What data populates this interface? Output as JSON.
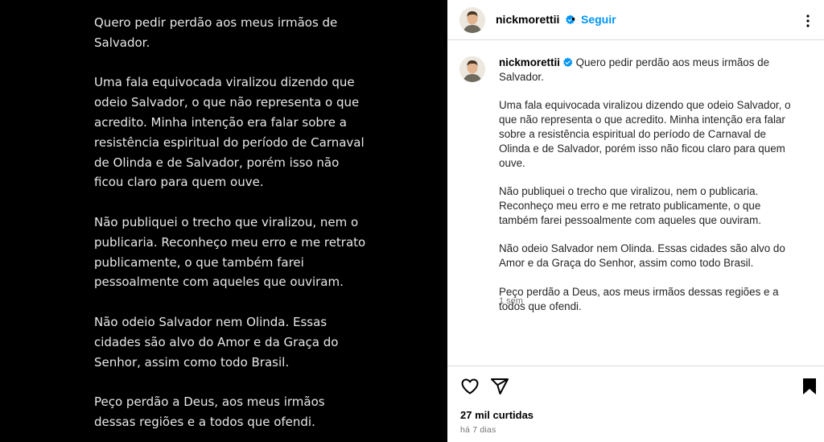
{
  "media": {
    "paragraphs": [
      "Quero pedir perdão aos meus irmãos de Salvador.",
      "Uma fala equivocada viralizou dizendo que odeio Salvador, o que não representa o que acredito. Minha intenção era falar sobre a resistência espiritual do período de Carnaval de Olinda e de Salvador, porém isso não ficou claro para quem ouve.",
      "Não publiquei o trecho que viralizou, nem o publicaria. Reconheço meu erro e me retrato publicamente, o que também farei pessoalmente com aqueles que ouviram.",
      "Não odeio Salvador nem Olinda. Essas cidades são alvo do Amor e da Graça do Senhor, assim como todo Brasil.",
      "Peço perdão a Deus, aos meus irmãos dessas regiões e a todos que ofendi."
    ]
  },
  "header": {
    "username": "nickmorettii",
    "separator": "•",
    "follow_label": "Seguir"
  },
  "caption": {
    "username": "nickmorettii",
    "first": "Quero pedir perdão aos meus irmãos de Salvador.",
    "p2": "Uma fala equivocada viralizou dizendo que odeio Salvador, o que não representa o que acredito. Minha intenção era falar sobre a resistência espiritual do período de Carnaval de Olinda e de Salvador, porém isso não ficou claro para quem ouve.",
    "p3": "Não publiquei o trecho que viralizou, nem o publicaria. Reconheço meu erro e me retrato publicamente, o que também farei pessoalmente com aqueles que ouviram.",
    "p4": "Não odeio Salvador nem Olinda. Essas cidades são alvo do Amor e da Graça do Senhor, assim como todo Brasil.",
    "p5": "Peço perdão a Deus, aos meus irmãos dessas regiões e a todos que ofendi.",
    "time": "1 sem"
  },
  "actions": {
    "likes": "27 mil curtidas",
    "posted": "há 7 dias",
    "icons": [
      "heart-icon",
      "share-icon",
      "bookmark-icon",
      "more-icon",
      "verified-badge-icon"
    ]
  },
  "colors": {
    "accent": "#0095f6",
    "verified": "#0095f6",
    "media_bg": "#000000",
    "border": "#dbdbdb"
  }
}
